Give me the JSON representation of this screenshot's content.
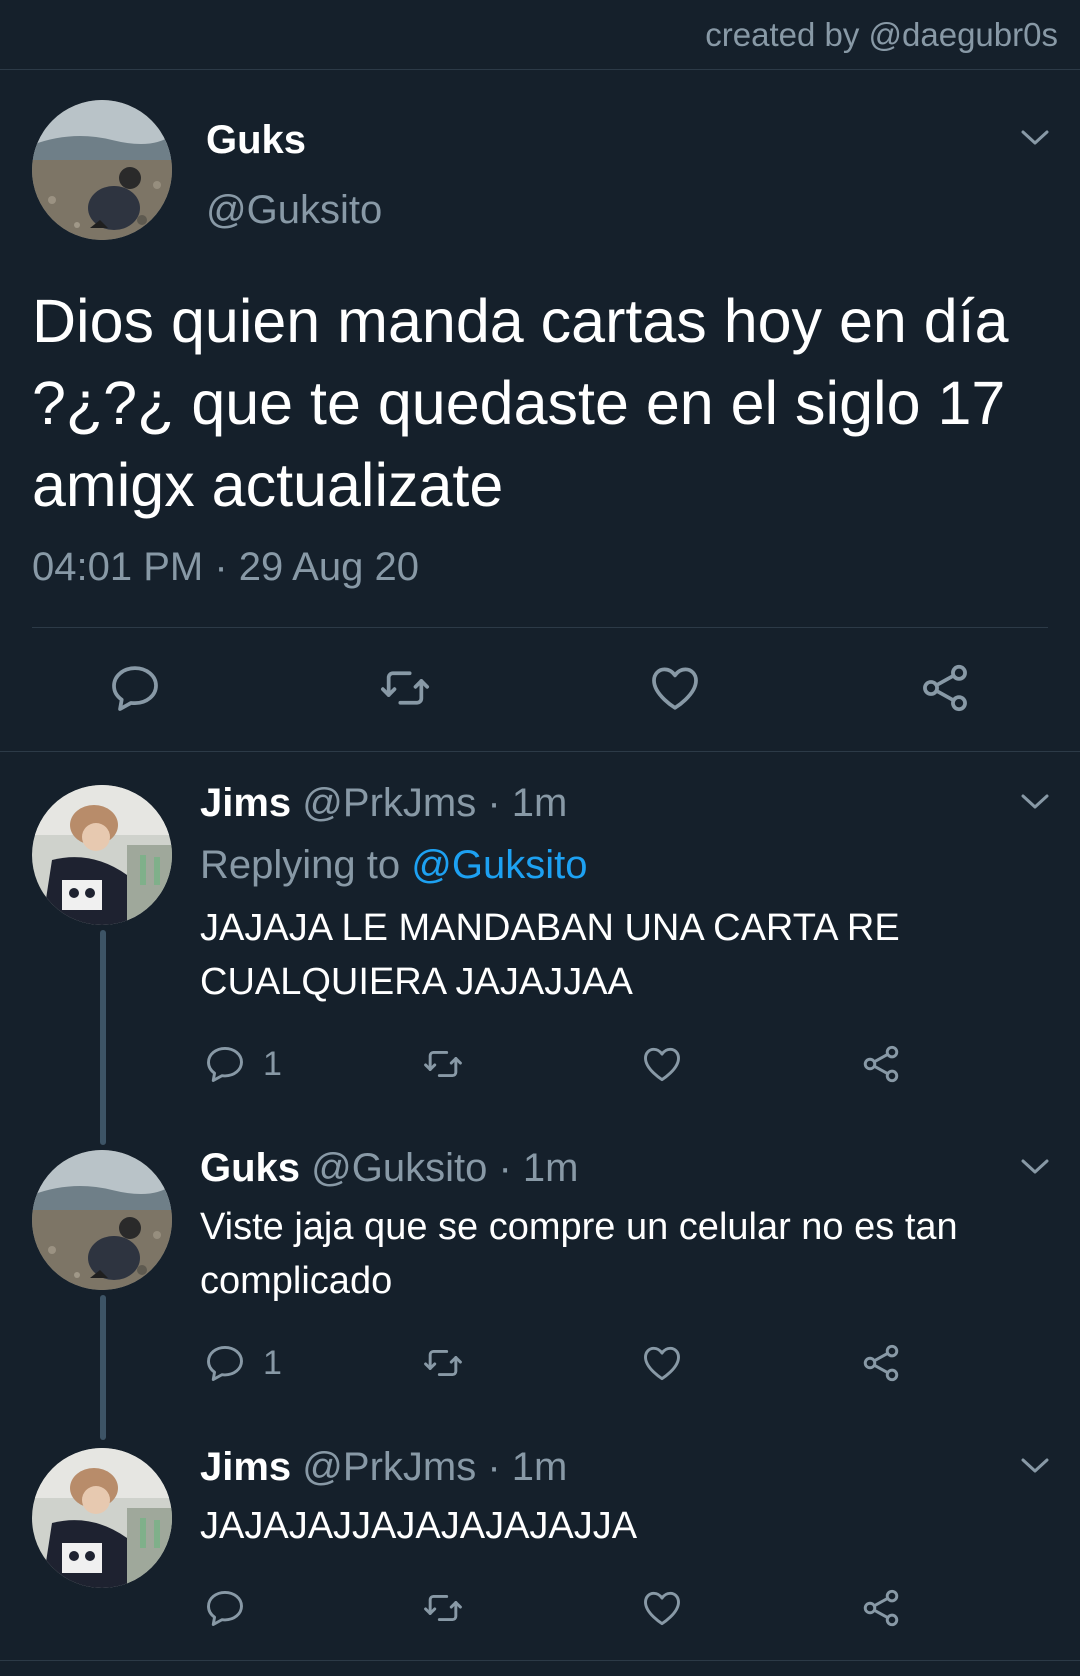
{
  "credit": "created by @daegubr0s",
  "colors": {
    "background": "#15202b",
    "secondary_text": "#8899a6",
    "link": "#1da1f2",
    "divider": "#2c3a47",
    "thread_line": "#3d5466"
  },
  "main_tweet": {
    "name": "Guks",
    "handle": "@Guksito",
    "text": "Dios quien manda cartas hoy en día ?¿?¿ que te quedaste en el siglo 17 amigx actualizate",
    "timestamp": "04:01 PM · 29 Aug 20",
    "actions": [
      "reply-icon",
      "retweet-icon",
      "like-icon",
      "share-icon"
    ]
  },
  "replies": [
    {
      "name": "Jims",
      "meta": "@PrkJms · 1m",
      "replying_label": "Replying to",
      "replying_to": "@Guksito",
      "text": "JAJAJA LE MANDABAN UNA CARTA RE CUALQUIERA JAJAJJAA",
      "reply_count": "1"
    },
    {
      "name": "Guks",
      "meta": "@Guksito · 1m",
      "text": "Viste jaja que se compre un celular no es tan complicado",
      "reply_count": "1"
    },
    {
      "name": "Jims",
      "meta": "@PrkJms · 1m",
      "text": "JAJAJAJJAJAJAJAJAJJA",
      "reply_count": ""
    }
  ]
}
